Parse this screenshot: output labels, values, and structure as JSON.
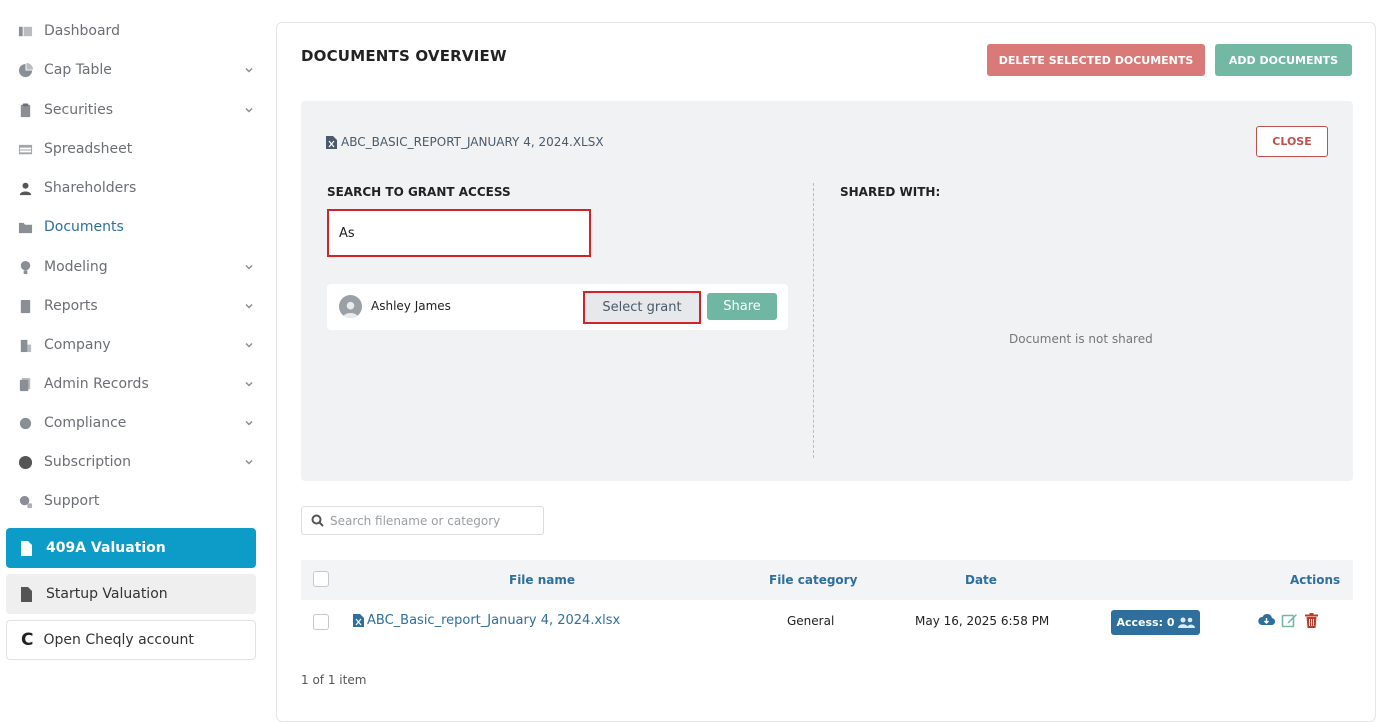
{
  "sidebar": {
    "items": [
      {
        "label": "Dashboard",
        "icon": "dashboard-icon",
        "has_chevron": false
      },
      {
        "label": "Cap Table",
        "icon": "pie-chart-icon",
        "has_chevron": true
      },
      {
        "label": "Securities",
        "icon": "clipboard-icon",
        "has_chevron": true
      },
      {
        "label": "Spreadsheet",
        "icon": "table-icon",
        "has_chevron": false
      },
      {
        "label": "Shareholders",
        "icon": "user-icon",
        "has_chevron": false
      },
      {
        "label": "Documents",
        "icon": "folder-icon",
        "has_chevron": false,
        "active": true
      },
      {
        "label": "Modeling",
        "icon": "lightbulb-icon",
        "has_chevron": true
      },
      {
        "label": "Reports",
        "icon": "report-icon",
        "has_chevron": true
      },
      {
        "label": "Company",
        "icon": "building-icon",
        "has_chevron": true
      },
      {
        "label": "Admin Records",
        "icon": "records-icon",
        "has_chevron": true
      },
      {
        "label": "Compliance",
        "icon": "shield-check-icon",
        "has_chevron": true
      },
      {
        "label": "Subscription",
        "icon": "dollar-circle-icon",
        "has_chevron": true
      },
      {
        "label": "Support",
        "icon": "support-icon",
        "has_chevron": false
      }
    ],
    "valuation_label": "409A Valuation",
    "startup_label": "Startup Valuation",
    "cheqly_logo": "C",
    "cheqly_label": "Open Cheqly account"
  },
  "main": {
    "title": "DOCUMENTS OVERVIEW",
    "delete_label": "DELETE SELECTED DOCUMENTS",
    "add_label": "ADD DOCUMENTS"
  },
  "share_panel": {
    "file_title": "ABC_BASIC_REPORT_JANUARY 4, 2024.XLSX",
    "close_label": "CLOSE",
    "search_label": "SEARCH TO GRANT ACCESS",
    "search_value": "As",
    "result_user": "Ashley James",
    "select_grant_label": "Select grant",
    "share_label": "Share",
    "shared_with_label": "SHARED WITH:",
    "not_shared_text": "Document is not shared"
  },
  "filter": {
    "placeholder": "Search filename or category"
  },
  "table": {
    "headers": {
      "file_name": "File name",
      "file_category": "File category",
      "date": "Date",
      "actions": "Actions"
    },
    "rows": [
      {
        "file_name": "ABC_Basic_report_January 4, 2024.xlsx",
        "category": "General",
        "date": "May 16, 2025 6:58 PM",
        "access": "Access: 0"
      }
    ],
    "pager": "1 of 1 item"
  },
  "colors": {
    "accent": "#0d9bc8",
    "link": "#2e6f9e",
    "delete": "#d97a78",
    "add": "#73b8a3",
    "highlight": "#d0232a"
  }
}
